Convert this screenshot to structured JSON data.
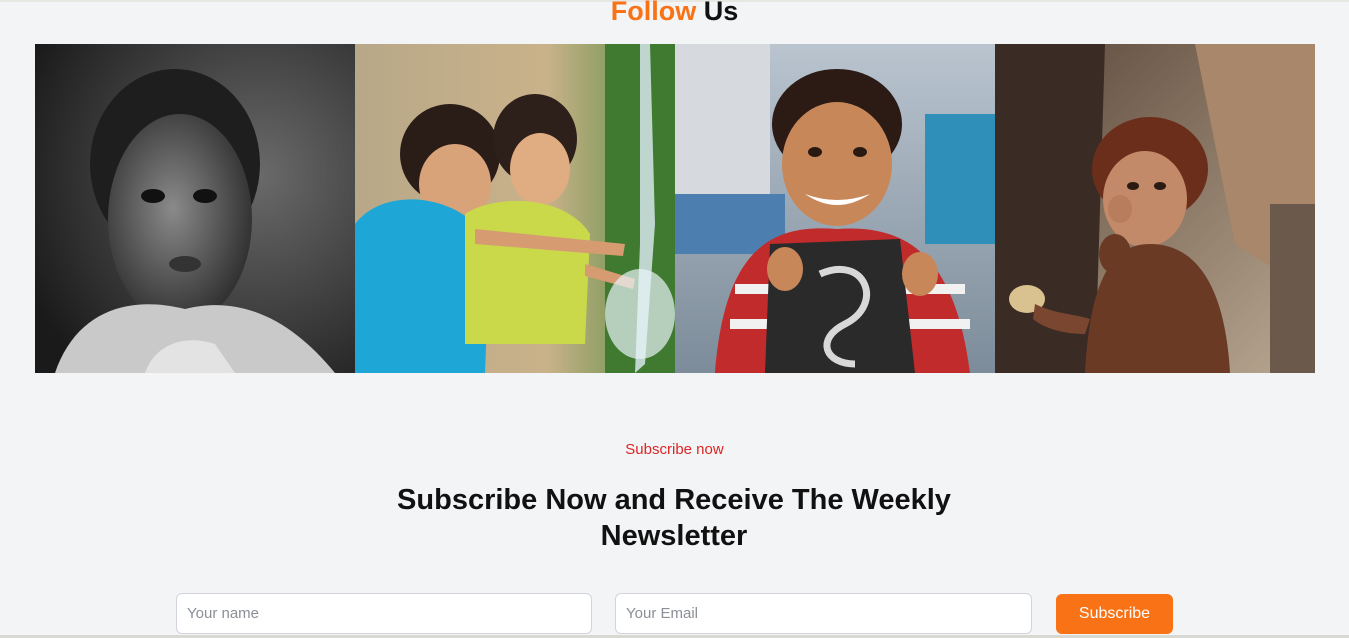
{
  "follow": {
    "title_accent": "Follow",
    "title_rest": " Us"
  },
  "gallery": {
    "photos": [
      {
        "subject": "child-portrait-bw"
      },
      {
        "subject": "children-playing-with-water"
      },
      {
        "subject": "smiling-boy-with-slate"
      },
      {
        "subject": "toddler-eating-bread"
      }
    ]
  },
  "newsletter": {
    "eyebrow": "Subscribe now",
    "headline": "Subscribe Now and Receive The Weekly Newsletter",
    "name_placeholder": "Your name",
    "email_placeholder": "Your Email",
    "button_label": "Subscribe"
  },
  "colors": {
    "accent": "#f97316",
    "eyebrow": "#dc2626",
    "background": "#f3f4f6"
  }
}
